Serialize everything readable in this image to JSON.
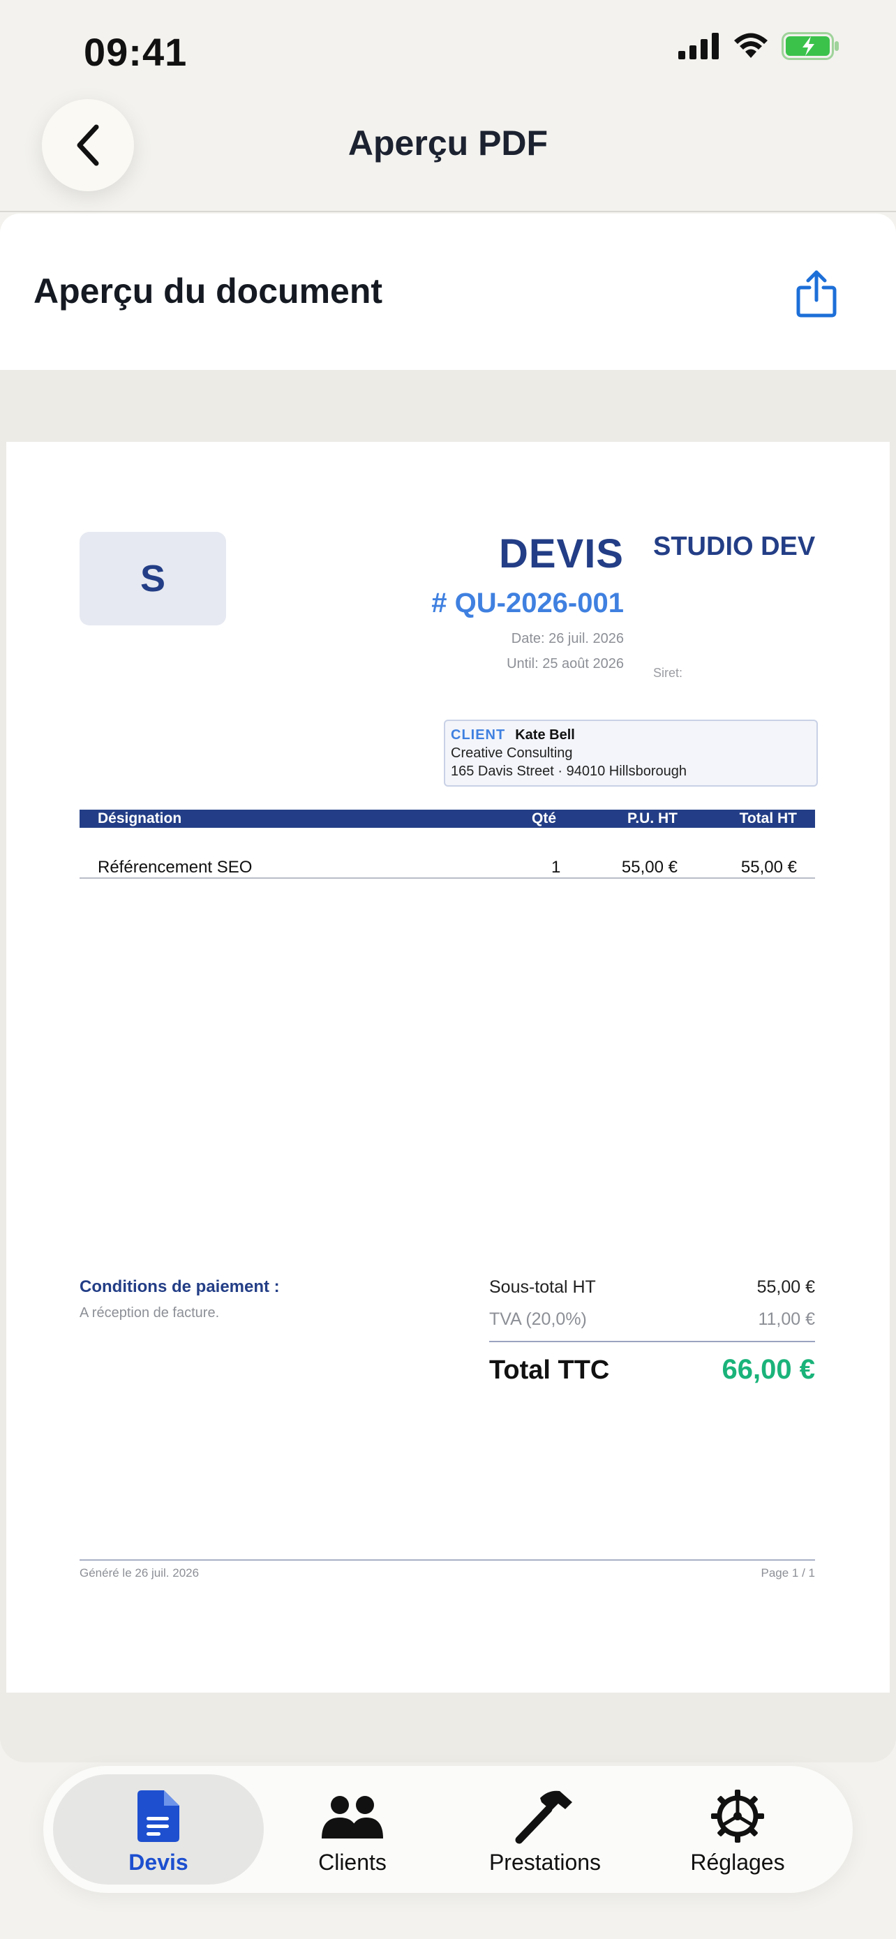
{
  "status_bar": {
    "time": "09:41"
  },
  "nav": {
    "title": "Aperçu PDF"
  },
  "header": {
    "title": "Aperçu du document"
  },
  "document": {
    "logo_letter": "S",
    "doc_type": "DEVIS",
    "number": "# QU-2026-001",
    "date": "Date: 26 juil. 2026",
    "until": "Until: 25 août 2026",
    "company": "STUDIO DEV",
    "siret": "Siret:",
    "client": {
      "tag": "CLIENT",
      "name": "Kate Bell",
      "company": "Creative Consulting",
      "address": "165 Davis Street · 94010 Hillsborough"
    },
    "table": {
      "headers": [
        "Désignation",
        "Qté",
        "P.U. HT",
        "Total HT"
      ],
      "rows": [
        [
          "Référencement SEO",
          "1",
          "55,00 €",
          "55,00 €"
        ]
      ]
    },
    "payment": {
      "title": "Conditions de paiement :",
      "text": "A réception de facture."
    },
    "totals": {
      "subtotal_label": "Sous-total HT",
      "subtotal_value": "55,00 €",
      "tva_label": "TVA (20,0%)",
      "tva_value": "11,00 €",
      "total_label": "Total TTC",
      "total_value": "66,00 €"
    },
    "footer": {
      "generated": "Généré le 26 juil. 2026",
      "page": "Page 1 / 1"
    }
  },
  "tabs": [
    {
      "label": "Devis",
      "icon": "document-icon",
      "active": true
    },
    {
      "label": "Clients",
      "icon": "people-icon",
      "active": false
    },
    {
      "label": "Prestations",
      "icon": "hammer-icon",
      "active": false
    },
    {
      "label": "Réglages",
      "icon": "gear-icon",
      "active": false
    }
  ],
  "colors": {
    "brand": "#233e86",
    "accent": "#3f80e0",
    "total": "#1ab37a",
    "tab_active": "#1d4fcf"
  }
}
